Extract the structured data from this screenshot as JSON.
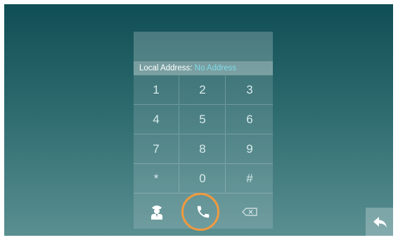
{
  "local_address": {
    "label": "Local Address:",
    "value": "No Address"
  },
  "keypad": {
    "keys": [
      "1",
      "2",
      "3",
      "4",
      "5",
      "6",
      "7",
      "8",
      "9",
      "*",
      "0",
      "#"
    ]
  },
  "actions": {
    "guard_icon": "security-guard-icon",
    "call_icon": "phone-handset-icon",
    "delete_icon": "backspace-icon"
  },
  "colors": {
    "highlight_ring": "#f19a3e",
    "address_value": "#7fdbe8"
  },
  "back_icon": "back-arrow-icon"
}
